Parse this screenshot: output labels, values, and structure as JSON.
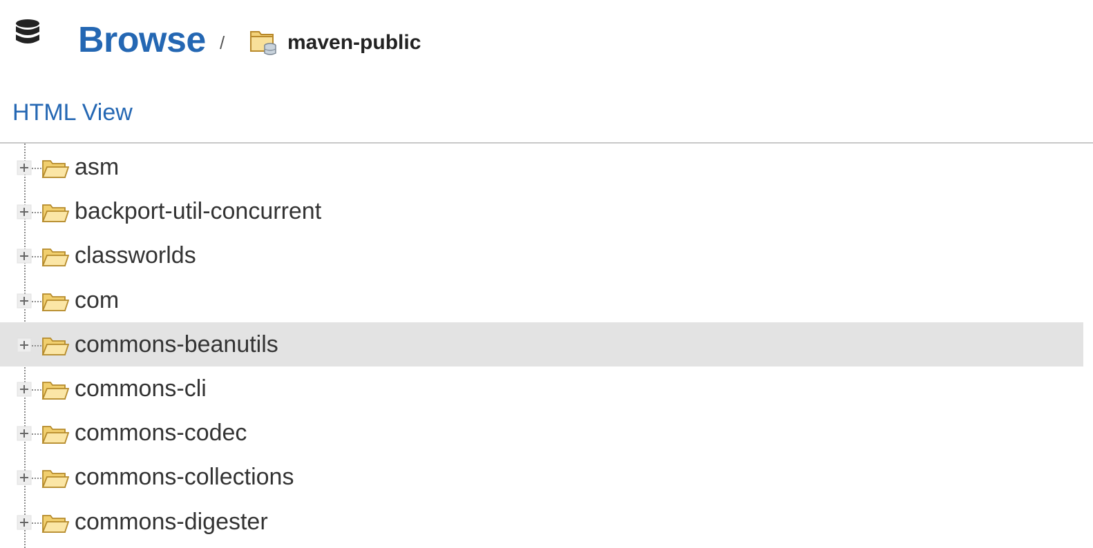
{
  "header": {
    "title": "Browse",
    "separator": "/",
    "repository": "maven-public",
    "title_color": "#2467b3"
  },
  "view_link": {
    "label": "HTML View"
  },
  "tree": {
    "selected_index": 4,
    "selected_bg": "#e3e3e3",
    "items": [
      {
        "label": "asm",
        "icon": "folder-icon",
        "expander": "plus-icon"
      },
      {
        "label": "backport-util-concurrent",
        "icon": "folder-icon",
        "expander": "plus-icon"
      },
      {
        "label": "classworlds",
        "icon": "folder-icon",
        "expander": "plus-icon"
      },
      {
        "label": "com",
        "icon": "folder-icon",
        "expander": "plus-icon"
      },
      {
        "label": "commons-beanutils",
        "icon": "folder-icon",
        "expander": "plus-icon"
      },
      {
        "label": "commons-cli",
        "icon": "folder-icon",
        "expander": "plus-icon"
      },
      {
        "label": "commons-codec",
        "icon": "folder-icon",
        "expander": "plus-icon"
      },
      {
        "label": "commons-collections",
        "icon": "folder-icon",
        "expander": "plus-icon"
      },
      {
        "label": "commons-digester",
        "icon": "folder-icon",
        "expander": "plus-icon"
      }
    ]
  }
}
